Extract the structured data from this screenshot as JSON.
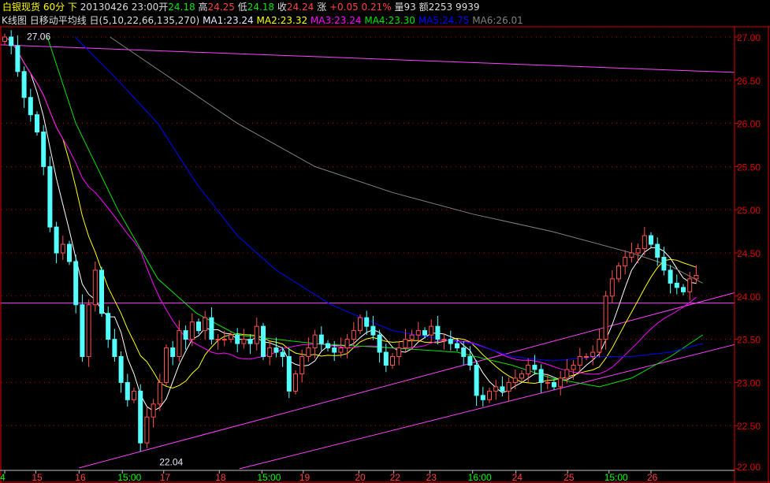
{
  "header": {
    "symbol": "白银现货",
    "period": "60分",
    "direction": "下",
    "datetime": "20130426 23:00",
    "open_label": "开",
    "open": "24.18",
    "high_label": "高",
    "high": "24.25",
    "low_label": "低",
    "low": "24.18",
    "close_label": "收",
    "close": "24.24",
    "change_label": "涨",
    "change": "+0.05",
    "change_pct": "0.21%",
    "volume_label": "量",
    "volume": "93",
    "amount_label": "额",
    "amount": "2253 9939"
  },
  "indicator": {
    "chart_type": "K线图",
    "name": "日移动平均线",
    "params": "日(5,10,22,66,135,270)",
    "ma1": "MA1:23.24",
    "ma2": "MA2:23.32",
    "ma3": "MA3:23.24",
    "ma4": "MA4:23.30",
    "ma5": "MA5:24.75",
    "ma6": "MA6:26.01"
  },
  "colors": {
    "background": "#000000",
    "up": "#ff5050",
    "down": "#54ffff",
    "grid": "#c00000",
    "ma1": "#ffffff",
    "ma2": "#ffff00",
    "ma3": "#ff00ff",
    "ma4": "#00e600",
    "ma5": "#0000ff",
    "ma6": "#808080",
    "trendline": "#ff40ff",
    "axis_text": "#e00000"
  },
  "chart_data": {
    "type": "candlestick",
    "ylim": [
      22.0,
      27.0
    ],
    "yticks": [
      "27.00",
      "26.50",
      "26.00",
      "25.50",
      "25.00",
      "24.50",
      "24.00",
      "23.50",
      "23.00",
      "22.50",
      "22.00"
    ],
    "closes": [
      27.0,
      26.9,
      26.6,
      26.3,
      26.1,
      25.9,
      25.5,
      24.8,
      24.5,
      24.6,
      24.4,
      23.9,
      23.3,
      23.9,
      24.3,
      23.8,
      23.5,
      23.3,
      23.0,
      22.8,
      22.9,
      22.3,
      22.6,
      22.75,
      23.0,
      23.4,
      23.3,
      23.6,
      23.5,
      23.7,
      23.6,
      23.75,
      23.5,
      23.5,
      23.5,
      23.55,
      23.45,
      23.5,
      23.45,
      23.65,
      23.3,
      23.4,
      23.35,
      23.3,
      22.9,
      23.1,
      23.3,
      23.4,
      23.55,
      23.45,
      23.4,
      23.35,
      23.4,
      23.5,
      23.6,
      23.75,
      23.65,
      23.55,
      23.35,
      23.2,
      23.3,
      23.4,
      23.5,
      23.55,
      23.6,
      23.55,
      23.65,
      23.5,
      23.5,
      23.45,
      23.4,
      23.3,
      23.2,
      22.85,
      22.8,
      22.9,
      22.95,
      22.9,
      23.0,
      23.05,
      23.1,
      23.2,
      23.15,
      23.0,
      23.0,
      22.95,
      23.05,
      23.15,
      23.2,
      23.3,
      23.3,
      23.35,
      23.5,
      24.0,
      24.2,
      24.35,
      24.45,
      24.5,
      24.55,
      24.7,
      24.6,
      24.45,
      24.3,
      24.15,
      24.1,
      24.05,
      24.2,
      24.24
    ],
    "first_open": 26.95,
    "computed_ma": [
      {
        "name": "MA1",
        "period": 5
      },
      {
        "name": "MA2",
        "period": 10
      },
      {
        "name": "MA3",
        "period": 22
      }
    ],
    "sampled_ma": [
      {
        "name": "MA4",
        "points": [
          [
            6.6,
            27.0
          ],
          [
            11,
            26.0
          ],
          [
            17.5,
            25.0
          ],
          [
            23.7,
            24.2
          ],
          [
            29.7,
            23.8
          ],
          [
            36,
            23.55
          ],
          [
            48,
            23.45
          ],
          [
            60,
            23.4
          ],
          [
            70,
            23.35
          ],
          [
            78.5,
            23.2
          ],
          [
            84.6,
            23.05
          ],
          [
            92,
            22.95
          ],
          [
            97,
            23.05
          ],
          [
            103,
            23.3
          ],
          [
            108,
            23.55
          ]
        ]
      },
      {
        "name": "MA5",
        "points": [
          [
            10.9,
            27.0
          ],
          [
            17.5,
            26.5
          ],
          [
            23.7,
            26.0
          ],
          [
            29.7,
            25.3
          ],
          [
            36,
            24.7
          ],
          [
            42,
            24.3
          ],
          [
            50.5,
            23.9
          ],
          [
            60,
            23.6
          ],
          [
            67.6,
            23.5
          ],
          [
            72.4,
            23.45
          ],
          [
            78.5,
            23.3
          ],
          [
            84.6,
            23.25
          ],
          [
            92,
            23.3
          ],
          [
            97,
            23.3
          ],
          [
            103,
            23.35
          ],
          [
            108,
            23.45
          ]
        ]
      },
      {
        "name": "MA6",
        "points": [
          [
            16.3,
            27.0
          ],
          [
            36,
            26.0
          ],
          [
            48,
            25.5
          ],
          [
            60,
            25.2
          ],
          [
            72.4,
            24.95
          ],
          [
            84.6,
            24.75
          ],
          [
            97,
            24.5
          ],
          [
            103,
            24.35
          ],
          [
            108,
            24.15
          ]
        ]
      }
    ],
    "trendlines": [
      [
        [
          -0.7,
          26.91
        ],
        [
          113,
          26.59
        ]
      ],
      [
        [
          -0.7,
          23.92
        ],
        [
          113,
          23.92
        ]
      ],
      [
        [
          11.5,
          22.01
        ],
        [
          113,
          24.04
        ]
      ],
      [
        [
          36.3,
          22.0
        ],
        [
          113,
          23.44
        ]
      ]
    ],
    "annotations": [
      {
        "text": "27.06",
        "index": 0.5,
        "price": 27.06
      },
      {
        "text": "22.04",
        "index": 21,
        "price": 22.04
      }
    ],
    "xticks": [
      {
        "label": "4",
        "index": 0,
        "kind": "time"
      },
      {
        "label": "15",
        "index": 4.8,
        "kind": "day"
      },
      {
        "label": "16",
        "index": 11.5,
        "kind": "day"
      },
      {
        "label": "15:00",
        "index": 18.2,
        "kind": "time"
      },
      {
        "label": "17",
        "index": 24.6,
        "kind": "day"
      },
      {
        "label": "18",
        "index": 33.2,
        "kind": "day"
      },
      {
        "label": "15:00",
        "index": 39.8,
        "kind": "time"
      },
      {
        "label": "19",
        "index": 46.2,
        "kind": "day"
      },
      {
        "label": "20",
        "index": 54.8,
        "kind": "day"
      },
      {
        "label": "22",
        "index": 60.2,
        "kind": "day"
      },
      {
        "label": "23",
        "index": 65.8,
        "kind": "day"
      },
      {
        "label": "16:00",
        "index": 72.4,
        "kind": "time"
      },
      {
        "label": "24",
        "index": 79.1,
        "kind": "day"
      },
      {
        "label": "25",
        "index": 87.1,
        "kind": "day"
      },
      {
        "label": "15:00",
        "index": 93.5,
        "kind": "time"
      },
      {
        "label": "26",
        "index": 100,
        "kind": "day"
      }
    ]
  }
}
